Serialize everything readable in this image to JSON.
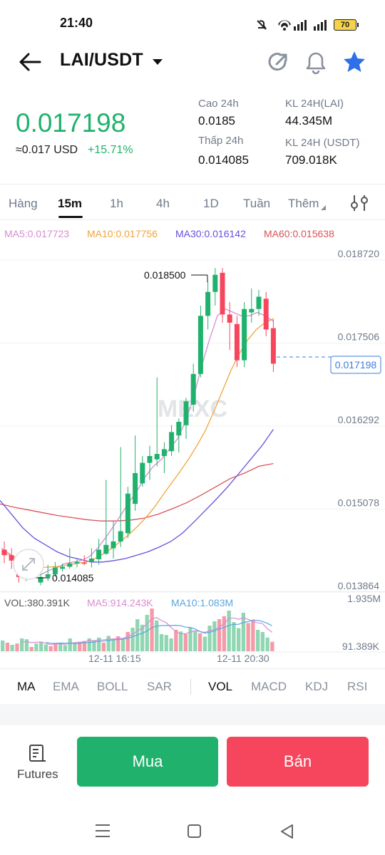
{
  "status_bar": {
    "time": "21:40",
    "battery": "70"
  },
  "header": {
    "pair": "LAI/USDT"
  },
  "price": {
    "last": "0.017198",
    "usd": "≈0.017 USD",
    "change": "+15.71%",
    "high_label": "Cao 24h",
    "high": "0.0185",
    "low_label": "Thấp 24h",
    "low": "0.014085",
    "vol_lai_label": "KL 24H(LAI)",
    "vol_lai": "44.345M",
    "vol_usdt_label": "KL 24H (USDT)",
    "vol_usdt": "709.018K"
  },
  "tabs": [
    "Hàng",
    "15m",
    "1h",
    "4h",
    "1D",
    "Tuần",
    "Thêm"
  ],
  "active_tab": "15m",
  "ma_legend": {
    "ma5": "MA5:0.017723",
    "ma10": "MA10:0.017756",
    "ma30": "MA30:0.016142",
    "ma60": "MA60:0.015638"
  },
  "colors": {
    "up": "#20b26c",
    "down": "#f6465d",
    "ma5": "#d98cd2",
    "ma10": "#f0a53a",
    "ma30": "#6a4ee0",
    "ma60": "#d9535b"
  },
  "chart": {
    "watermark": "MEXC",
    "y_labels": [
      "0.018720",
      "0.017506",
      "0.016292",
      "0.015078",
      "0.013864"
    ],
    "current_price": "0.017198",
    "high_annotation": "0.018500",
    "low_annotation": "0.014085",
    "volume": {
      "vol": "VOL:380.391K",
      "ma5": "MA5:914.243K",
      "ma10": "MA10:1.083M",
      "top": "1.935M",
      "bottom": "91.389K"
    },
    "x_labels": [
      "12-11 16:15",
      "12-11 20:30"
    ]
  },
  "chart_data": {
    "type": "candlestick",
    "ylim": [
      0.013864,
      0.01872
    ],
    "candles": [
      {
        "o": 0.01438,
        "h": 0.0145,
        "l": 0.01418,
        "c": 0.0143
      },
      {
        "o": 0.0143,
        "h": 0.0144,
        "l": 0.0141,
        "c": 0.01422
      },
      {
        "o": 0.01422,
        "h": 0.01432,
        "l": 0.0139,
        "c": 0.01398
      },
      {
        "o": 0.01398,
        "h": 0.01412,
        "l": 0.01392,
        "c": 0.01408
      },
      {
        "o": 0.0141,
        "h": 0.01432,
        "l": 0.01408,
        "c": 0.01415
      },
      {
        "o": 0.0139,
        "h": 0.0142,
        "l": 0.01386,
        "c": 0.01398
      },
      {
        "o": 0.01398,
        "h": 0.01416,
        "l": 0.01392,
        "c": 0.01402
      },
      {
        "o": 0.01402,
        "h": 0.0142,
        "l": 0.01398,
        "c": 0.01412
      },
      {
        "o": 0.0141,
        "h": 0.01418,
        "l": 0.01406,
        "c": 0.01413
      },
      {
        "o": 0.01413,
        "h": 0.0144,
        "l": 0.0141,
        "c": 0.01418
      },
      {
        "o": 0.01418,
        "h": 0.01425,
        "l": 0.01412,
        "c": 0.0142
      },
      {
        "o": 0.01419,
        "h": 0.0143,
        "l": 0.01415,
        "c": 0.01418
      },
      {
        "o": 0.0142,
        "h": 0.0144,
        "l": 0.01412,
        "c": 0.01425
      },
      {
        "o": 0.01424,
        "h": 0.01454,
        "l": 0.01416,
        "c": 0.01438
      },
      {
        "o": 0.01432,
        "h": 0.0154,
        "l": 0.0143,
        "c": 0.01445
      },
      {
        "o": 0.0144,
        "h": 0.0148,
        "l": 0.01425,
        "c": 0.0145
      },
      {
        "o": 0.0145,
        "h": 0.01588,
        "l": 0.01442,
        "c": 0.01465
      },
      {
        "o": 0.01462,
        "h": 0.0153,
        "l": 0.01455,
        "c": 0.0152
      },
      {
        "o": 0.01505,
        "h": 0.01605,
        "l": 0.01495,
        "c": 0.0155
      },
      {
        "o": 0.01535,
        "h": 0.01575,
        "l": 0.0153,
        "c": 0.01565
      },
      {
        "o": 0.01565,
        "h": 0.0159,
        "l": 0.0154,
        "c": 0.01575
      },
      {
        "o": 0.0157,
        "h": 0.0169,
        "l": 0.0156,
        "c": 0.01578
      },
      {
        "o": 0.01575,
        "h": 0.01595,
        "l": 0.0155,
        "c": 0.01585
      },
      {
        "o": 0.01582,
        "h": 0.0162,
        "l": 0.01575,
        "c": 0.0161
      },
      {
        "o": 0.01605,
        "h": 0.0163,
        "l": 0.0158,
        "c": 0.01625
      },
      {
        "o": 0.0162,
        "h": 0.0166,
        "l": 0.016,
        "c": 0.01655
      },
      {
        "o": 0.0165,
        "h": 0.0171,
        "l": 0.0164,
        "c": 0.01695
      },
      {
        "o": 0.01695,
        "h": 0.01795,
        "l": 0.0169,
        "c": 0.0178
      },
      {
        "o": 0.0178,
        "h": 0.0183,
        "l": 0.0176,
        "c": 0.01815
      },
      {
        "o": 0.01815,
        "h": 0.0185,
        "l": 0.01795,
        "c": 0.0184
      },
      {
        "o": 0.01843,
        "h": 0.0185,
        "l": 0.0177,
        "c": 0.01782
      },
      {
        "o": 0.01782,
        "h": 0.018,
        "l": 0.0173,
        "c": 0.0177
      },
      {
        "o": 0.01768,
        "h": 0.0178,
        "l": 0.01705,
        "c": 0.01715
      },
      {
        "o": 0.01715,
        "h": 0.018,
        "l": 0.01705,
        "c": 0.0179
      },
      {
        "o": 0.01785,
        "h": 0.0182,
        "l": 0.0177,
        "c": 0.0179
      },
      {
        "o": 0.0179,
        "h": 0.01818,
        "l": 0.0178,
        "c": 0.01808
      },
      {
        "o": 0.01805,
        "h": 0.01815,
        "l": 0.0175,
        "c": 0.0176
      },
      {
        "o": 0.01762,
        "h": 0.01775,
        "l": 0.01698,
        "c": 0.0171
      }
    ],
    "ma5": [
      0.0144,
      0.01432,
      0.01422,
      0.01412,
      0.01405,
      0.01402,
      0.01408,
      0.01412,
      0.01418,
      0.0142,
      0.01422,
      0.01428,
      0.0144,
      0.01455,
      0.01472,
      0.0149,
      0.01508,
      0.01525,
      0.01545,
      0.0156,
      0.0157,
      0.01585,
      0.016,
      0.01625,
      0.0166,
      0.01705,
      0.01745,
      0.0178,
      0.0179,
      0.01785,
      0.0178,
      0.0178,
      0.01785,
      0.0178,
      0.01772
    ],
    "ma10": [
      0.01435,
      0.0143,
      0.01425,
      0.01418,
      0.01414,
      0.01412,
      0.01413,
      0.01414,
      0.01416,
      0.01418,
      0.0142,
      0.01425,
      0.01432,
      0.0144,
      0.0145,
      0.0146,
      0.01472,
      0.01485,
      0.015,
      0.01518,
      0.01535,
      0.01552,
      0.0157,
      0.0159,
      0.01612,
      0.0164,
      0.0167,
      0.017,
      0.01725,
      0.01745,
      0.0176,
      0.0177,
      0.01776
    ],
    "ma30": [
      0.0151,
      0.0149,
      0.0147,
      0.01455,
      0.01445,
      0.01435,
      0.01428,
      0.01424,
      0.0142,
      0.0142,
      0.01422,
      0.01425,
      0.0143,
      0.01435,
      0.01442,
      0.0145,
      0.01462,
      0.01478,
      0.01495,
      0.01512,
      0.0153,
      0.0155,
      0.0157,
      0.0159,
      0.01614
    ],
    "ma60": [
      0.01505,
      0.015,
      0.01496,
      0.01492,
      0.01488,
      0.01485,
      0.01482,
      0.0148,
      0.0148,
      0.01481,
      0.01484,
      0.0149,
      0.01498,
      0.01507,
      0.01518,
      0.0153,
      0.01542,
      0.0155,
      0.0156,
      0.01564
    ],
    "volumes": [
      0.25,
      0.2,
      0.15,
      0.18,
      0.3,
      0.28,
      0.1,
      0.18,
      0.22,
      0.16,
      0.12,
      0.18,
      0.2,
      0.14,
      0.3,
      0.18,
      0.22,
      0.24,
      0.3,
      0.26,
      0.32,
      0.2,
      0.36,
      0.28,
      0.35,
      0.3,
      0.45,
      0.55,
      0.75,
      0.62,
      0.85,
      1.0,
      0.72,
      0.4,
      0.38,
      0.3,
      0.5,
      0.46,
      0.4,
      0.56,
      0.48,
      0.42,
      0.34,
      0.6,
      0.7,
      0.75,
      0.82,
      0.95,
      0.68,
      0.54,
      0.9,
      0.66,
      0.72,
      0.5,
      0.45,
      0.32,
      0.22
    ]
  },
  "indicators": [
    "MA",
    "EMA",
    "BOLL",
    "SAR",
    "VOL",
    "MACD",
    "KDJ",
    "RSI"
  ],
  "indicators_active": [
    "MA",
    "VOL"
  ],
  "footer": {
    "futures": "Futures",
    "buy": "Mua",
    "sell": "Bán"
  }
}
